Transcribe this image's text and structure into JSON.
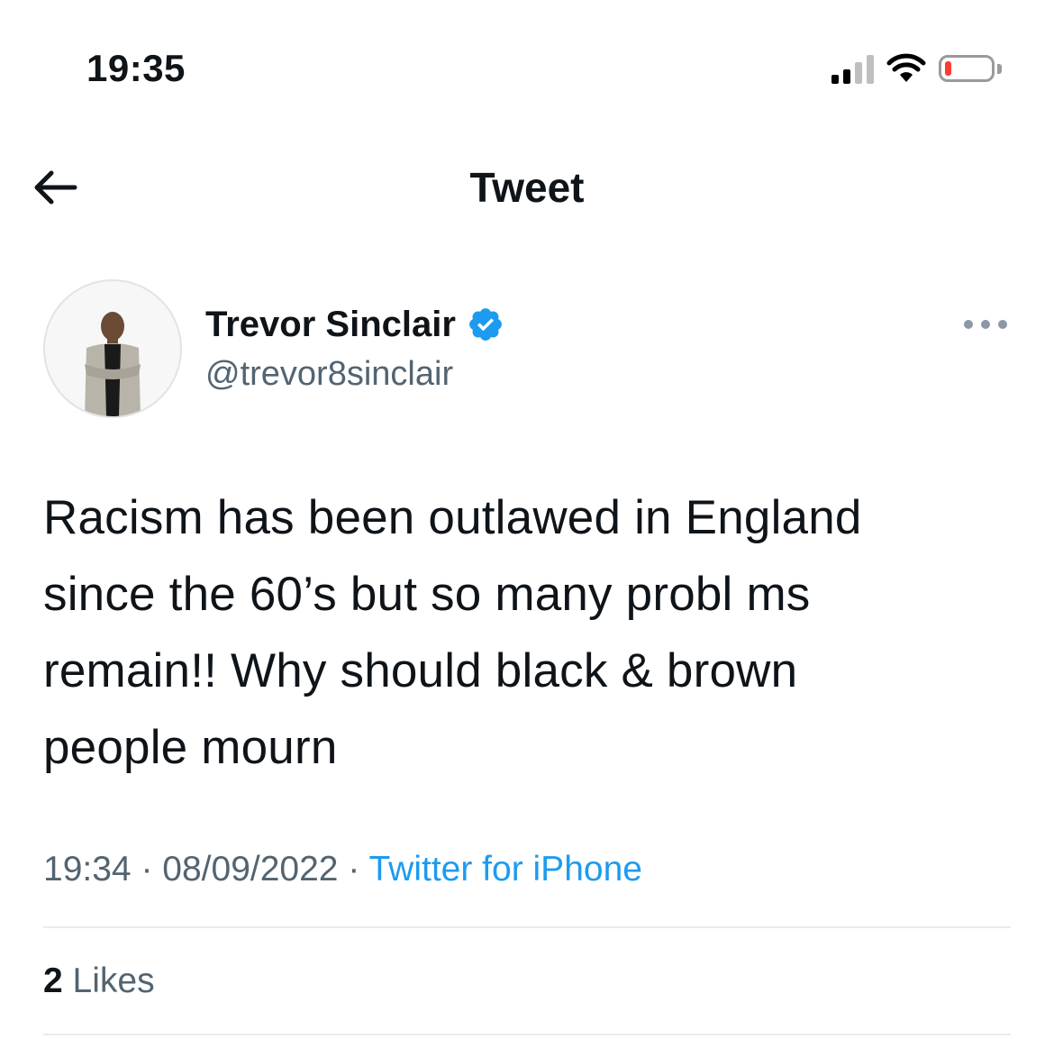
{
  "status_bar": {
    "time": "19:35",
    "signal_icon": "cellular-signal-icon",
    "wifi_icon": "wifi-icon",
    "battery_icon": "battery-low-icon",
    "battery_level_color": "#ff3b30"
  },
  "header": {
    "back_icon": "arrow-left-icon",
    "title": "Tweet"
  },
  "author": {
    "name": "Trevor Sinclair",
    "handle": "@trevor8sinclair",
    "verified_icon": "verified-badge-icon",
    "verified_color": "#1d9bf0",
    "more_icon": "more-horizontal-icon"
  },
  "tweet": {
    "text": "Racism has been outlawed in England\nsince the 60’s but so many probl ms\nremain!! Why should black & brown\npeople mourn",
    "time": "19:34",
    "separator": "·",
    "date": "08/09/2022",
    "source": "Twitter for iPhone",
    "source_color": "#1d9bf0"
  },
  "stats": {
    "likes_count": "2",
    "likes_label": "Likes"
  }
}
